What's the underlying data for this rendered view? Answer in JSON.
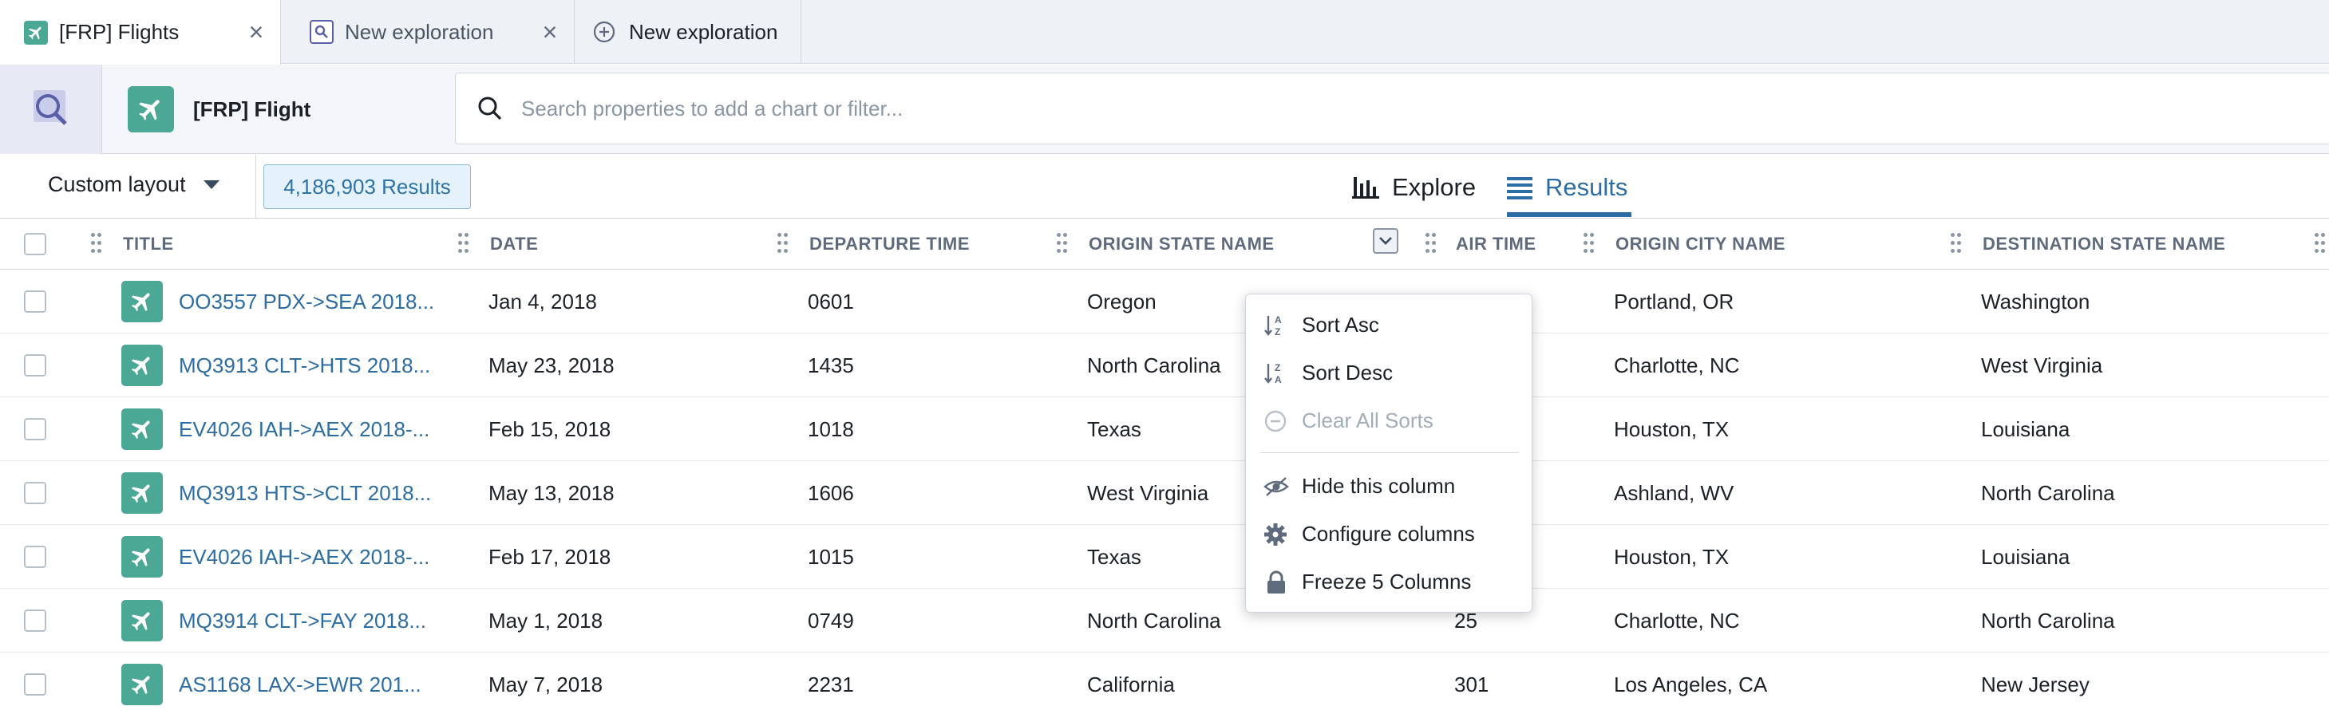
{
  "tabs": [
    {
      "label": "[FRP] Flights",
      "icon": "airplane-icon",
      "active": true,
      "closable": true
    },
    {
      "label": "New exploration",
      "icon": "exploration-icon",
      "active": false,
      "closable": true
    },
    {
      "label": "New exploration",
      "icon": "plus-circle-icon",
      "active": false,
      "closable": false
    }
  ],
  "header": {
    "object_type": "[FRP] Flight",
    "search_placeholder": "Search properties to add a chart or filter..."
  },
  "toolbar": {
    "layout_label": "Custom layout",
    "results_count": "4,186,903 Results",
    "view_tabs": [
      {
        "label": "Explore",
        "icon": "bar-chart-icon",
        "active": false
      },
      {
        "label": "Results",
        "icon": "list-icon",
        "active": true
      }
    ]
  },
  "table": {
    "columns": [
      "TITLE",
      "DATE",
      "DEPARTURE TIME",
      "ORIGIN STATE NAME",
      "AIR TIME",
      "ORIGIN CITY NAME",
      "DESTINATION STATE NAME"
    ],
    "rows": [
      {
        "title": "OO3557 PDX->SEA 2018...",
        "date": "Jan 4, 2018",
        "departure_time": "0601",
        "origin_state": "Oregon",
        "air_time": "",
        "origin_city": "Portland, OR",
        "dest_state": "Washington"
      },
      {
        "title": "MQ3913 CLT->HTS 2018...",
        "date": "May 23, 2018",
        "departure_time": "1435",
        "origin_state": "North Carolina",
        "air_time": "",
        "origin_city": "Charlotte, NC",
        "dest_state": "West Virginia"
      },
      {
        "title": "EV4026 IAH->AEX 2018-...",
        "date": "Feb 15, 2018",
        "departure_time": "1018",
        "origin_state": "Texas",
        "air_time": "",
        "origin_city": "Houston, TX",
        "dest_state": "Louisiana"
      },
      {
        "title": "MQ3913 HTS->CLT 2018...",
        "date": "May 13, 2018",
        "departure_time": "1606",
        "origin_state": "West Virginia",
        "air_time": "",
        "origin_city": "Ashland, WV",
        "dest_state": "North Carolina"
      },
      {
        "title": "EV4026 IAH->AEX 2018-...",
        "date": "Feb 17, 2018",
        "departure_time": "1015",
        "origin_state": "Texas",
        "air_time": "",
        "origin_city": "Houston, TX",
        "dest_state": "Louisiana"
      },
      {
        "title": "MQ3914 CLT->FAY 2018...",
        "date": "May 1, 2018",
        "departure_time": "0749",
        "origin_state": "North Carolina",
        "air_time": "25",
        "origin_city": "Charlotte, NC",
        "dest_state": "North Carolina"
      },
      {
        "title": "AS1168 LAX->EWR 201...",
        "date": "May 7, 2018",
        "departure_time": "2231",
        "origin_state": "California",
        "air_time": "301",
        "origin_city": "Los Angeles, CA",
        "dest_state": "New Jersey"
      }
    ]
  },
  "column_menu": {
    "items": [
      {
        "label": "Sort Asc",
        "icon": "sort-asc-icon",
        "disabled": false
      },
      {
        "label": "Sort Desc",
        "icon": "sort-desc-icon",
        "disabled": false
      },
      {
        "label": "Clear All Sorts",
        "icon": "clear-sorts-icon",
        "disabled": true
      },
      {
        "label": "Hide this column",
        "icon": "eye-off-icon",
        "disabled": false
      },
      {
        "label": "Configure columns",
        "icon": "gear-icon",
        "disabled": false
      },
      {
        "label": "Freeze 5 Columns",
        "icon": "lock-icon",
        "disabled": false
      }
    ]
  },
  "colors": {
    "accent": "#2d6da5",
    "object_icon": "#4aa895"
  }
}
